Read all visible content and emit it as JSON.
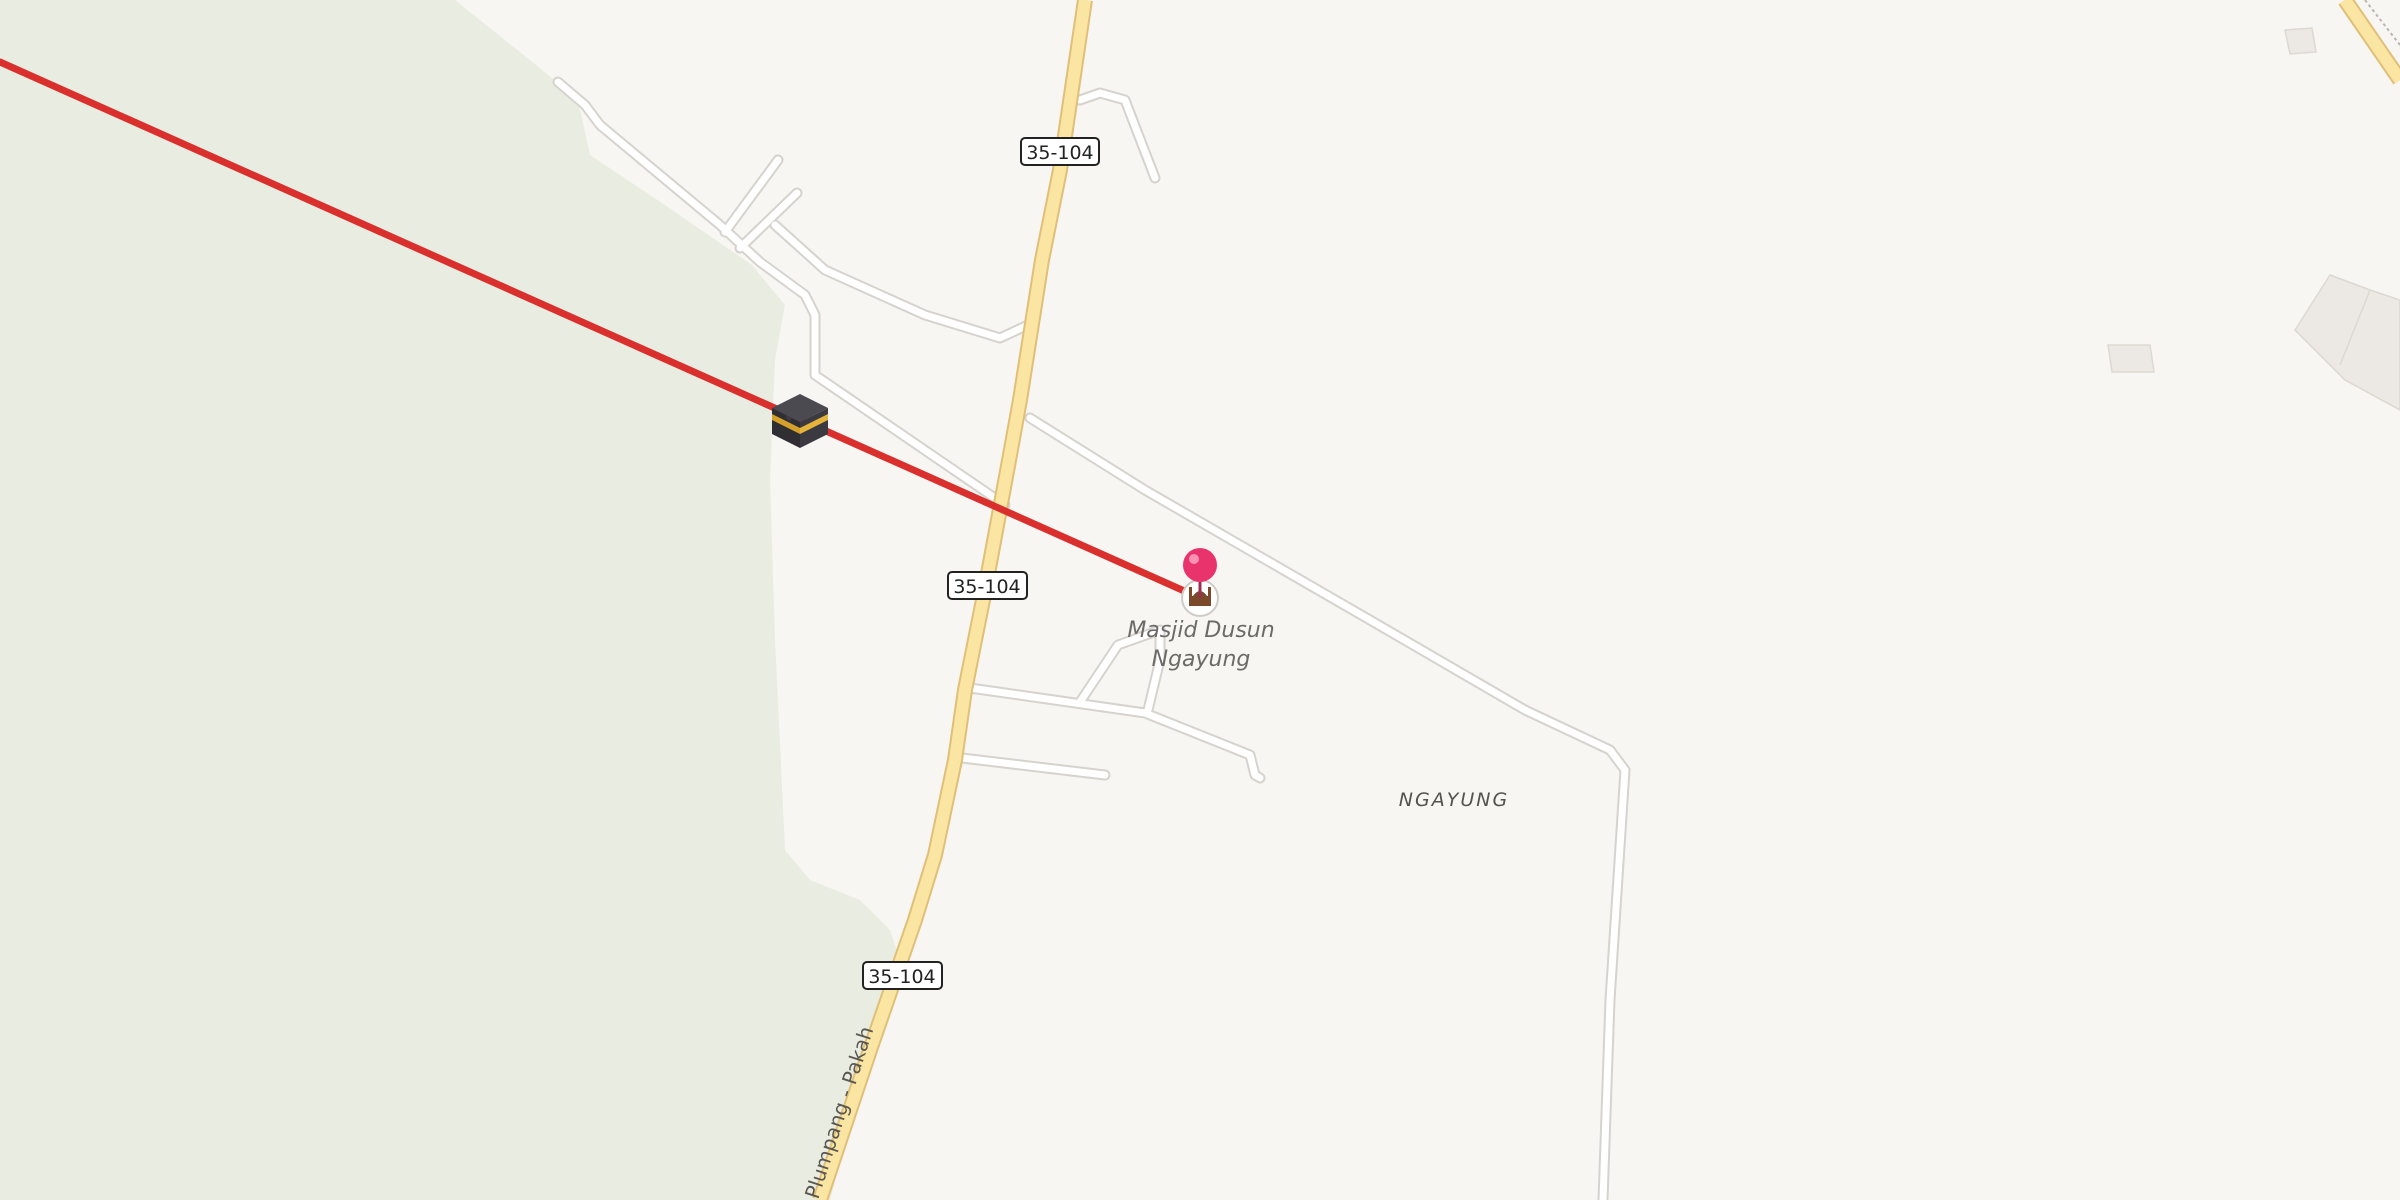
{
  "map": {
    "route_shields": [
      "35-104",
      "35-104",
      "35-104"
    ],
    "road_name": "Plumpang - Pakah",
    "poi": {
      "name_line1": "Masjid Dusun",
      "name_line2": "Ngayung",
      "icon": "mosque-icon"
    },
    "place_name": "NGAYUNG",
    "destination_icon": "kaaba-icon",
    "pin_icon": "location-pin-icon",
    "colors": {
      "land": "#f8f6f2",
      "park": "#e9ede1",
      "minor_road": "#ffffff",
      "minor_road_casing": "#d6d3ce",
      "primary_road": "#fbe5a2",
      "primary_road_casing": "#e0bf78",
      "qibla_line": "#d9302e",
      "pin": "#e8336c"
    }
  }
}
